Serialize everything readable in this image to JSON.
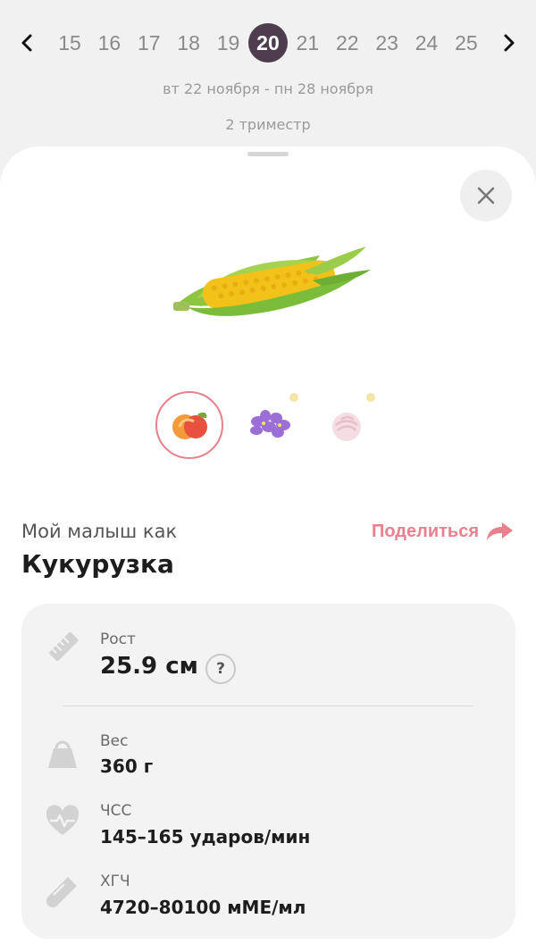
{
  "week_nav": {
    "weeks": [
      "15",
      "16",
      "17",
      "18",
      "19",
      "20",
      "21",
      "22",
      "23",
      "24",
      "25"
    ],
    "active_week": "20",
    "prev_icon": "chevron-left-icon",
    "next_icon": "chevron-right-icon"
  },
  "date_range": "вт 22 ноября - пн 28 ноября",
  "trimester": "2 триместр",
  "sheet": {
    "close_icon": "close-icon",
    "thumbnails": [
      {
        "name": "peach",
        "active": true
      },
      {
        "name": "violet-flowers",
        "active": false
      },
      {
        "name": "marshmallow",
        "active": false
      }
    ],
    "like_label": "Мой малыш как",
    "like_name": "Кукурузка",
    "share_label": "Поделиться",
    "share_icon": "share-arrow-icon"
  },
  "stats": {
    "height": {
      "label": "Рост",
      "value": "25.9 см",
      "help": "?",
      "icon": "ruler-icon"
    },
    "weight": {
      "label": "Вес",
      "value": "360 г",
      "icon": "weight-icon"
    },
    "heart_rate": {
      "label": "ЧСС",
      "value": "145–165 ударов/мин",
      "icon": "heart-pulse-icon"
    },
    "hcg": {
      "label": "ХГЧ",
      "value": "4720–80100 мМЕ/мл",
      "icon": "test-tube-icon"
    }
  },
  "colors": {
    "accent": "#e9808e",
    "active_week": "#4d3d4e",
    "card": "#f3f3f3"
  }
}
